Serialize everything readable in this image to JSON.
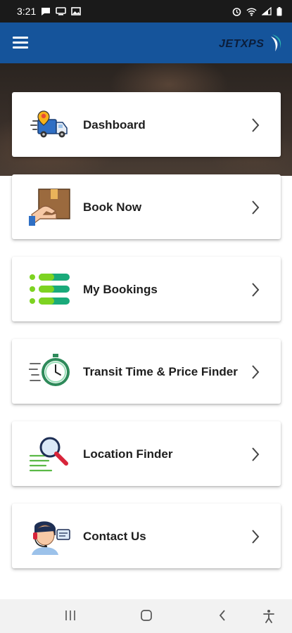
{
  "status_bar": {
    "time": "3:21",
    "left_icons": [
      "message-icon",
      "monitor-icon",
      "image-icon"
    ],
    "right_icons": [
      "alarm-icon",
      "wifi-icon",
      "signal-icon",
      "battery-icon"
    ]
  },
  "header": {
    "menu_icon": "hamburger-menu-icon",
    "logo_text": "JETXPS",
    "colors": {
      "bar": "#15549b",
      "logo_accent": "#2bb5b0"
    }
  },
  "menu": {
    "items": [
      {
        "label": "Dashboard",
        "icon": "delivery-truck-icon"
      },
      {
        "label": "Book Now",
        "icon": "package-hand-icon"
      },
      {
        "label": "My Bookings",
        "icon": "bookings-list-icon"
      },
      {
        "label": "Transit Time & Price Finder",
        "icon": "stopwatch-icon"
      },
      {
        "label": "Location Finder",
        "icon": "magnifier-icon"
      },
      {
        "label": "Contact Us",
        "icon": "support-agent-icon"
      }
    ],
    "chevron_icon": "chevron-right-icon"
  },
  "nav": {
    "buttons": [
      "recent-apps-icon",
      "home-icon",
      "back-icon",
      "accessibility-icon"
    ]
  }
}
